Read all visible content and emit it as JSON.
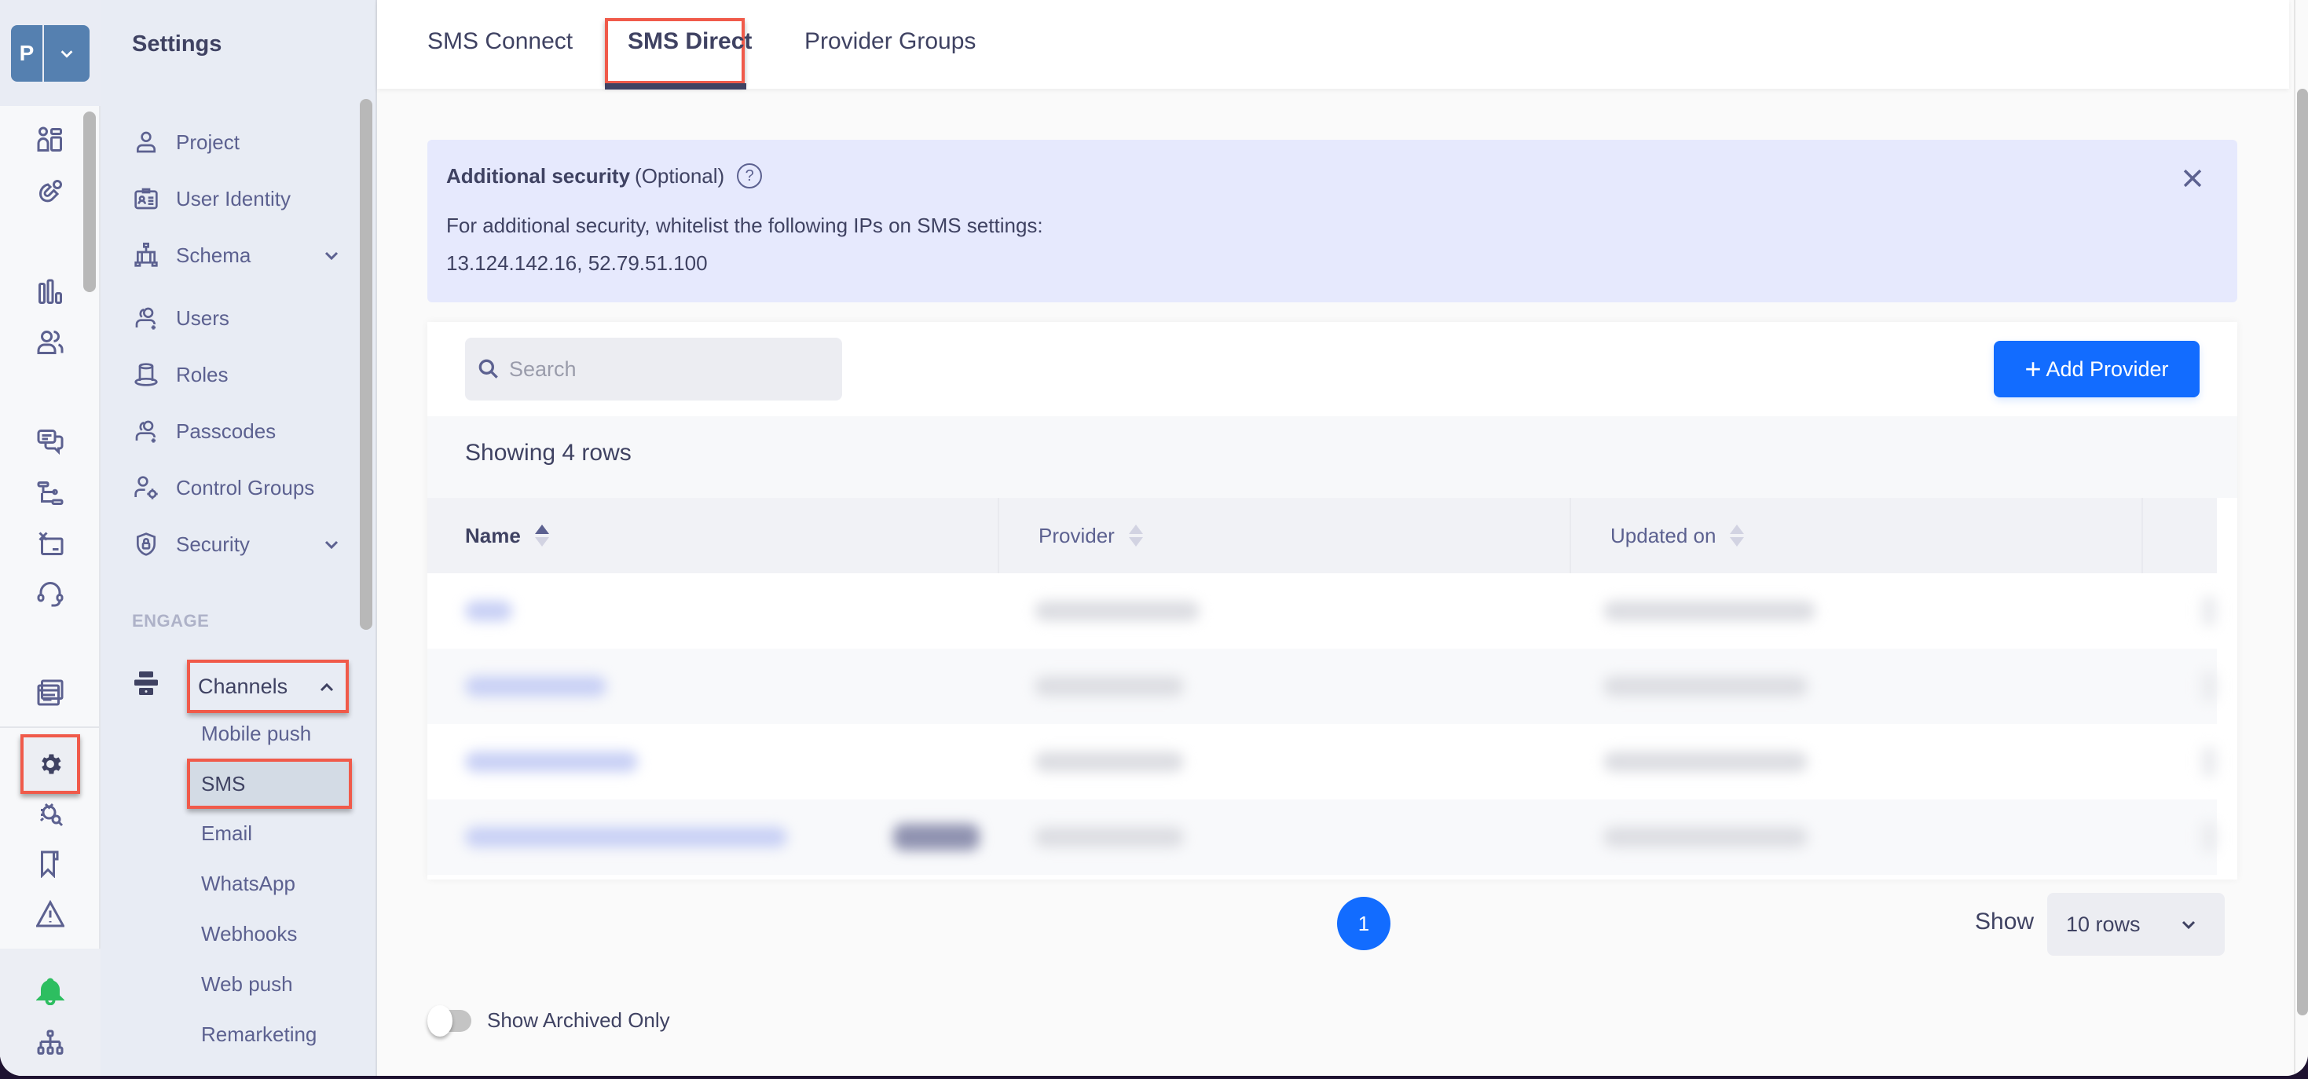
{
  "rail": {
    "project_initial": "P",
    "icons": [
      "dashboard-icon",
      "magnet-icon",
      "bar-chart-icon",
      "users-icon",
      "chat-icon",
      "flow-icon",
      "campaign-icon",
      "headset-icon",
      "templates-icon",
      "settings-gear-icon",
      "bug-search-icon",
      "bookmark-icon",
      "warning-icon",
      "notification-bell-icon",
      "org-tree-icon"
    ],
    "accent_color": "#2dbe60"
  },
  "sidebar": {
    "title": "Settings",
    "items": [
      {
        "label": "Project",
        "icon": "user-icon"
      },
      {
        "label": "User Identity",
        "icon": "id-card-icon"
      },
      {
        "label": "Schema",
        "icon": "schema-icon",
        "expandable": true
      },
      {
        "label": "Users",
        "icon": "users-add-icon"
      },
      {
        "label": "Roles",
        "icon": "hat-icon"
      },
      {
        "label": "Passcodes",
        "icon": "users-add-icon"
      },
      {
        "label": "Control Groups",
        "icon": "user-gear-icon"
      },
      {
        "label": "Security",
        "icon": "shield-lock-icon",
        "expandable": true
      }
    ],
    "section_label": "ENGAGE",
    "channels": {
      "label": "Channels",
      "expanded": true,
      "items": [
        "Mobile push",
        "SMS",
        "Email",
        "WhatsApp",
        "Webhooks",
        "Web push",
        "Remarketing"
      ],
      "active": "SMS"
    }
  },
  "tabs": [
    {
      "label": "SMS Connect",
      "active": false
    },
    {
      "label": "SMS Direct",
      "active": true
    },
    {
      "label": "Provider Groups",
      "active": false
    }
  ],
  "banner": {
    "title": "Additional security",
    "title_suffix": "(Optional)",
    "text": "For additional security, whitelist the following IPs on SMS settings:",
    "ips": "13.124.142.16, 52.79.51.100"
  },
  "toolbar": {
    "search_placeholder": "Search",
    "search_value": "",
    "add_button_label": "Add Provider",
    "primary_color": "#126cff"
  },
  "table": {
    "count_text": "Showing 4 rows",
    "columns": [
      {
        "label": "Name",
        "sort": "asc"
      },
      {
        "label": "Provider",
        "sort": "none"
      },
      {
        "label": "Updated on",
        "sort": "none"
      },
      {
        "label": "",
        "sort": "none"
      }
    ],
    "rows_redacted": true,
    "row_count": 4
  },
  "pagination": {
    "current_page": "1",
    "show_label": "Show",
    "rows_per_page": "10 rows"
  },
  "archive_toggle": {
    "label": "Show Archived Only",
    "checked": false
  }
}
